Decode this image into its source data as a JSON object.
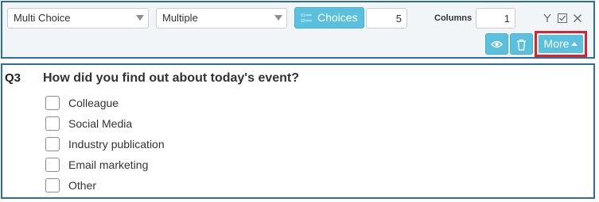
{
  "toolbar": {
    "question_type": "Multi Choice",
    "selection_mode": "Multiple",
    "choices_label": "Choices",
    "choices_count": "5",
    "columns_label": "Columns",
    "columns_count": "1",
    "more_label": "More",
    "icons": [
      "merge-icon",
      "checkbox-icon",
      "close-icon",
      "eye-icon",
      "trash-icon",
      "list-icon"
    ],
    "accent_color": "#5bc0de",
    "highlight_color": "#d9242c",
    "panel_border_color": "#2e6da4"
  },
  "question": {
    "number": "Q3",
    "text": "How did you find out about today's event?",
    "options": [
      {
        "label": "Colleague"
      },
      {
        "label": "Social Media"
      },
      {
        "label": "Industry publication"
      },
      {
        "label": "Email marketing"
      },
      {
        "label": "Other"
      }
    ]
  }
}
